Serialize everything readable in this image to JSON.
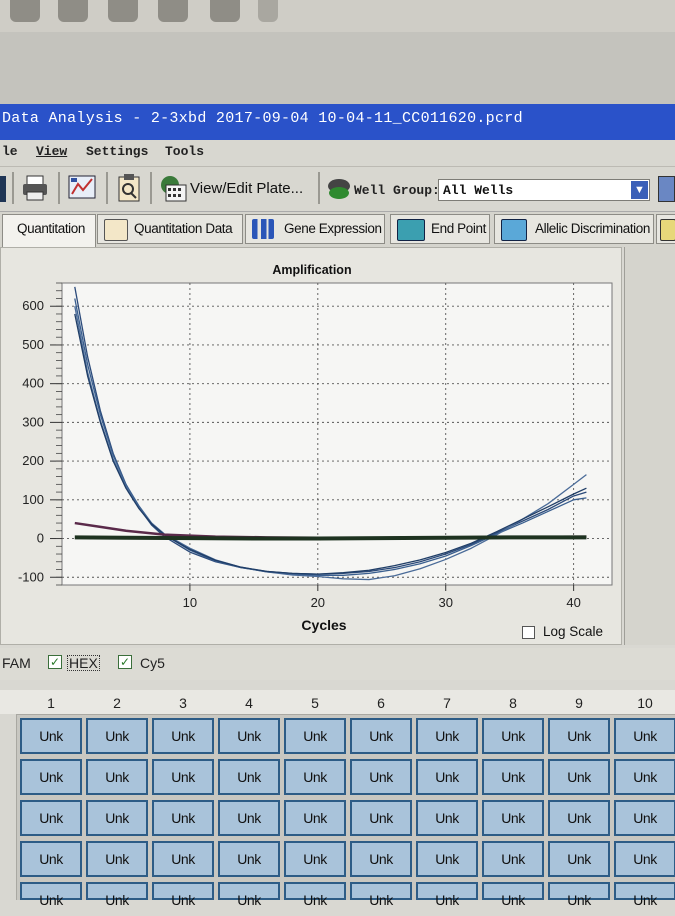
{
  "window": {
    "title": "Data Analysis - 2-3xbd 2017-09-04 10-04-11_CC011620.pcrd"
  },
  "menu": {
    "items": [
      "le",
      "View",
      "Settings",
      "Tools"
    ]
  },
  "toolbar": {
    "view_edit_plate": "View/Edit Plate...",
    "well_group_label": "Well Group:",
    "well_group_value": "All Wells",
    "icons": [
      "print-icon",
      "chart-export-icon",
      "clipboard-report-icon",
      "plate-edit-icon",
      "well-group-icon"
    ]
  },
  "tabs": [
    {
      "label": "Quantitation",
      "active": true
    },
    {
      "label": "Quantitation Data",
      "active": false
    },
    {
      "label": "Gene Expression",
      "active": false
    },
    {
      "label": "End Point",
      "active": false
    },
    {
      "label": "Allelic Discrimination",
      "active": false
    }
  ],
  "chart_data": {
    "type": "line",
    "title": "Amplification",
    "xlabel": "Cycles",
    "ylabel": "",
    "xlim": [
      0,
      43
    ],
    "ylim": [
      -120,
      660
    ],
    "xticks": [
      10,
      20,
      30,
      40
    ],
    "yticks": [
      600,
      500,
      400,
      300,
      200,
      100,
      0,
      -100
    ],
    "grid": true,
    "log_scale": false,
    "log_scale_label": "Log Scale",
    "series": [
      {
        "color": "#2b4a7a",
        "x": [
          1,
          2,
          3,
          4,
          5,
          6,
          7,
          8,
          10,
          12,
          14,
          16,
          18,
          20,
          22,
          24,
          26,
          28,
          30,
          32,
          34,
          36,
          38,
          40,
          41
        ],
        "y": [
          650,
          470,
          330,
          220,
          140,
          80,
          35,
          5,
          -35,
          -60,
          -75,
          -85,
          -90,
          -92,
          -90,
          -85,
          -75,
          -60,
          -40,
          -15,
          15,
          45,
          75,
          110,
          120
        ]
      },
      {
        "color": "#3a5f8f",
        "x": [
          1,
          2,
          3,
          4,
          5,
          6,
          7,
          8,
          10,
          12,
          14,
          16,
          18,
          20,
          22,
          24,
          26,
          28,
          30,
          32,
          34,
          36,
          38,
          40,
          41
        ],
        "y": [
          620,
          450,
          320,
          215,
          140,
          85,
          40,
          10,
          -30,
          -58,
          -75,
          -86,
          -92,
          -95,
          -95,
          -90,
          -80,
          -65,
          -45,
          -18,
          12,
          40,
          70,
          100,
          105
        ]
      },
      {
        "color": "#4a6b98",
        "x": [
          1,
          2,
          3,
          4,
          5,
          6,
          7,
          8,
          10,
          12,
          14,
          16,
          18,
          20,
          22,
          24,
          26,
          28,
          30,
          32,
          34,
          36,
          38,
          40,
          41
        ],
        "y": [
          600,
          430,
          305,
          205,
          135,
          80,
          40,
          12,
          -25,
          -55,
          -74,
          -86,
          -94,
          -98,
          -104,
          -106,
          -96,
          -78,
          -54,
          -25,
          10,
          50,
          90,
          140,
          165
        ]
      },
      {
        "color": "#1f3d66",
        "x": [
          1,
          2,
          3,
          4,
          5,
          6,
          7,
          8,
          10,
          12,
          14,
          16,
          18,
          20,
          22,
          24,
          26,
          28,
          30,
          32,
          34,
          36,
          38,
          40,
          41
        ],
        "y": [
          580,
          420,
          300,
          200,
          130,
          78,
          38,
          10,
          -28,
          -56,
          -74,
          -85,
          -90,
          -92,
          -88,
          -82,
          -70,
          -55,
          -36,
          -12,
          18,
          50,
          82,
          115,
          130
        ]
      },
      {
        "color": "#5a2a4a",
        "x": [
          1,
          3,
          5,
          8,
          12,
          16,
          20,
          25,
          30,
          35,
          41
        ],
        "y": [
          40,
          30,
          20,
          10,
          5,
          3,
          2,
          2,
          3,
          4,
          5
        ]
      },
      {
        "color": "#1e3320",
        "x": [
          1,
          5,
          10,
          15,
          20,
          25,
          30,
          35,
          41
        ],
        "y": [
          3,
          2,
          1,
          0,
          0,
          1,
          2,
          3,
          3
        ]
      }
    ]
  },
  "dyes": [
    {
      "label": "FAM",
      "checked": null
    },
    {
      "label": "HEX",
      "checked": true
    },
    {
      "label": "Cy5",
      "checked": true
    }
  ],
  "plate": {
    "columns": [
      "1",
      "2",
      "3",
      "4",
      "5",
      "6",
      "7",
      "8",
      "9",
      "10"
    ],
    "well_label": "Unk"
  }
}
